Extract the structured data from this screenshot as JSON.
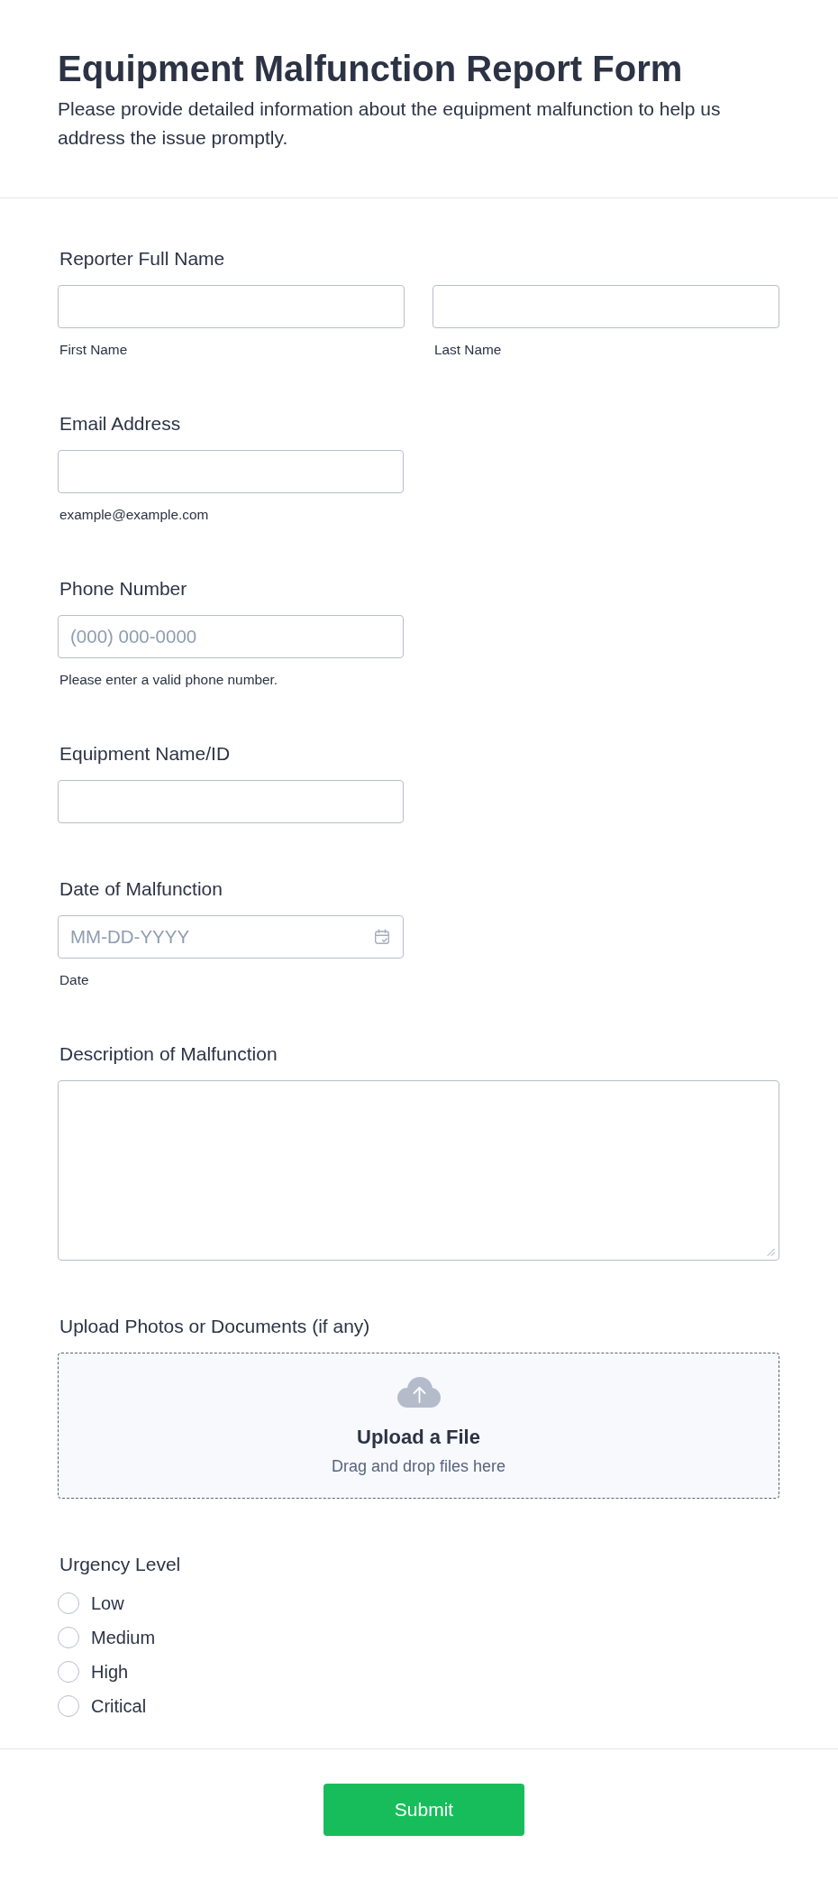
{
  "header": {
    "title": "Equipment Malfunction Report Form",
    "description": "Please provide detailed information about the equipment malfunction to help us address the issue promptly."
  },
  "fields": [
    {
      "kind": "name",
      "label": "Reporter Full Name",
      "inputs": [
        {
          "sublabel": "First Name"
        },
        {
          "sublabel": "Last Name"
        }
      ]
    },
    {
      "kind": "text",
      "label": "Email Address",
      "sublabel": "example@example.com"
    },
    {
      "kind": "text",
      "label": "Phone Number",
      "placeholder": "(000) 000-0000",
      "sublabel": "Please enter a valid phone number."
    },
    {
      "kind": "text",
      "label": "Equipment Name/ID"
    },
    {
      "kind": "date",
      "label": "Date of Malfunction",
      "placeholder": "MM-DD-YYYY",
      "sublabel": "Date"
    },
    {
      "kind": "textarea",
      "label": "Description of Malfunction"
    },
    {
      "kind": "upload",
      "label": "Upload Photos or Documents (if any)",
      "title": "Upload a File",
      "hint": "Drag and drop files here"
    },
    {
      "kind": "radio",
      "label": "Urgency Level",
      "options": [
        {
          "label": "Low",
          "selected": false
        },
        {
          "label": "Medium",
          "selected": false
        },
        {
          "label": "High",
          "selected": false
        },
        {
          "label": "Critical",
          "selected": false
        }
      ]
    }
  ],
  "submit": {
    "label": "Submit"
  }
}
